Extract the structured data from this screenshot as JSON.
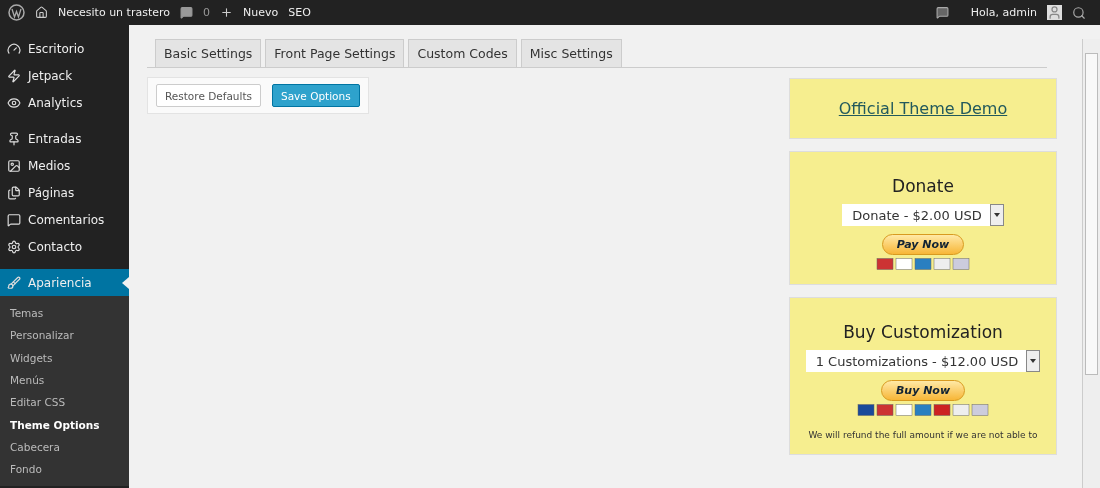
{
  "admin_bar": {
    "site_name": "Necesito un trastero",
    "comments_count": "0",
    "new_label": "Nuevo",
    "seo_label": "SEO",
    "greeting": "Hola, admin"
  },
  "sidebar": {
    "groups": [
      {
        "items": [
          {
            "label": "Escritorio",
            "kind": "gauge",
            "selected": false
          },
          {
            "label": "Jetpack",
            "kind": "jetpack",
            "selected": false
          },
          {
            "label": "Analytics",
            "kind": "analytics",
            "selected": false
          }
        ]
      },
      {
        "items": [
          {
            "label": "Entradas",
            "kind": "pin",
            "selected": false
          },
          {
            "label": "Medios",
            "kind": "media",
            "selected": false
          },
          {
            "label": "Páginas",
            "kind": "pages",
            "selected": false
          },
          {
            "label": "Comentarios",
            "kind": "comment",
            "selected": false
          },
          {
            "label": "Contacto",
            "kind": "gear",
            "selected": false
          }
        ]
      },
      {
        "items": [
          {
            "label": "Apariencia",
            "kind": "brush",
            "selected": true,
            "children": [
              {
                "label": "Temas",
                "selected": false
              },
              {
                "label": "Personalizar",
                "selected": false
              },
              {
                "label": "Widgets",
                "selected": false
              },
              {
                "label": "Menús",
                "selected": false
              },
              {
                "label": "Editar CSS",
                "selected": false
              },
              {
                "label": "Theme Options",
                "selected": true
              },
              {
                "label": "Cabecera",
                "selected": false
              },
              {
                "label": "Fondo",
                "selected": false
              }
            ]
          }
        ]
      }
    ]
  },
  "tabs": [
    {
      "label": "Basic Settings",
      "selected": false
    },
    {
      "label": "Front Page Settings",
      "selected": false
    },
    {
      "label": "Custom Codes",
      "selected": false
    },
    {
      "label": "Misc Settings",
      "selected": false
    }
  ],
  "buttons": [
    {
      "label": "Restore Defaults",
      "kind": "secondary"
    },
    {
      "label": "Save Options",
      "kind": "primary"
    }
  ],
  "side_cards": [
    {
      "kind": "link",
      "link": "Official Theme Demo"
    },
    {
      "kind": "payment",
      "title": "Donate",
      "select_value": "Donate - $2.00 USD",
      "pay_button": "Pay Now",
      "card_logos": [
        {
          "kind": "mastercard"
        },
        {
          "kind": "visa"
        },
        {
          "kind": "amex"
        },
        {
          "kind": "discover"
        },
        {
          "kind": "bank"
        }
      ]
    },
    {
      "kind": "payment",
      "title": "Buy Customization",
      "select_value": "1 Customizations - $12.00 USD",
      "pay_button": "Buy Now",
      "card_logos": [
        {
          "kind": "maestro"
        },
        {
          "kind": "mastercard"
        },
        {
          "kind": "visa"
        },
        {
          "kind": "amex"
        },
        {
          "kind": "unionpay"
        },
        {
          "kind": "discover"
        },
        {
          "kind": "bank"
        }
      ],
      "note": "We will refund the full amount if we are not able to"
    }
  ]
}
